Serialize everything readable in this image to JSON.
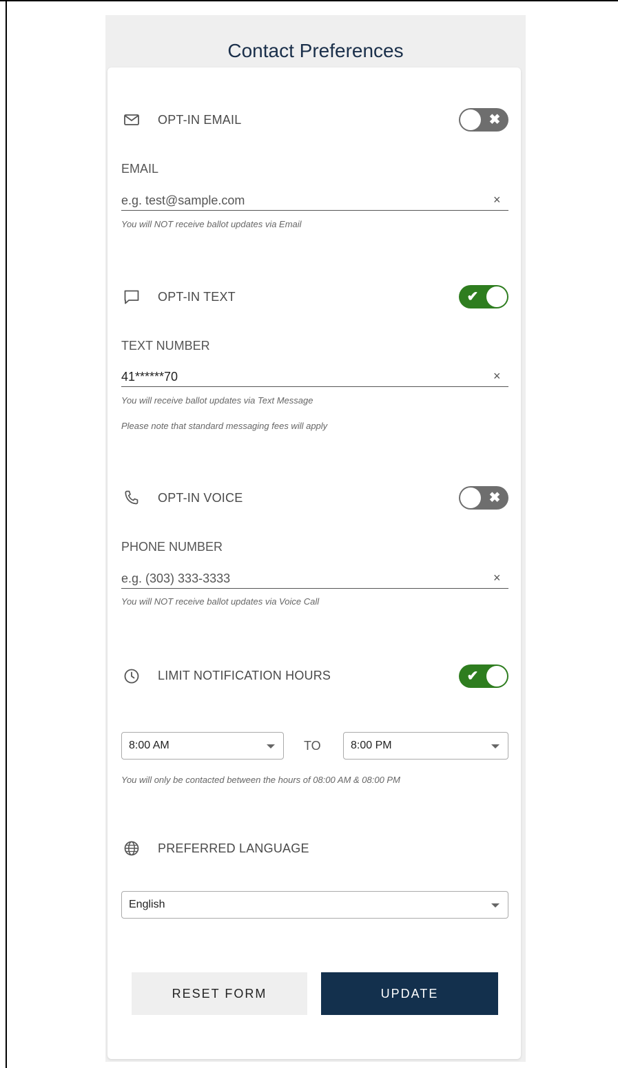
{
  "page": {
    "title": "Contact Preferences"
  },
  "email": {
    "section_title": "OPT-IN EMAIL",
    "icon": "envelope-icon",
    "enabled": false,
    "field_label": "EMAIL",
    "value": "",
    "placeholder": "e.g. test@sample.com",
    "hint": "You will NOT receive ballot updates via Email"
  },
  "text": {
    "section_title": "OPT-IN TEXT",
    "icon": "chat-bubble-icon",
    "enabled": true,
    "field_label": "TEXT NUMBER",
    "value": "41******70",
    "placeholder": "",
    "hint": "You will receive ballot updates via Text Message",
    "note": "Please note that standard messaging fees will apply"
  },
  "voice": {
    "section_title": "OPT-IN VOICE",
    "icon": "phone-icon",
    "enabled": false,
    "field_label": "PHONE NUMBER",
    "value": "",
    "placeholder": "e.g. (303) 333-3333",
    "hint": "You will NOT receive ballot updates via Voice Call"
  },
  "hours": {
    "section_title": "LIMIT NOTIFICATION HOURS",
    "icon": "clock-icon",
    "enabled": true,
    "start": "8:00 AM",
    "separator": "TO",
    "end": "8:00 PM",
    "hint": "You will only be contacted between the hours of 08:00 AM & 08:00 PM"
  },
  "language": {
    "section_title": "PREFERRED LANGUAGE",
    "icon": "globe-icon",
    "selected": "English"
  },
  "actions": {
    "reset_label": "RESET FORM",
    "update_label": "UPDATE"
  },
  "glyphs": {
    "clear": "×",
    "check": "✔",
    "cross": "✖"
  },
  "colors": {
    "toggle_on": "#2e7d1f",
    "toggle_off": "#6e6e6e",
    "primary": "#13304d",
    "title": "#1a2f4a"
  }
}
